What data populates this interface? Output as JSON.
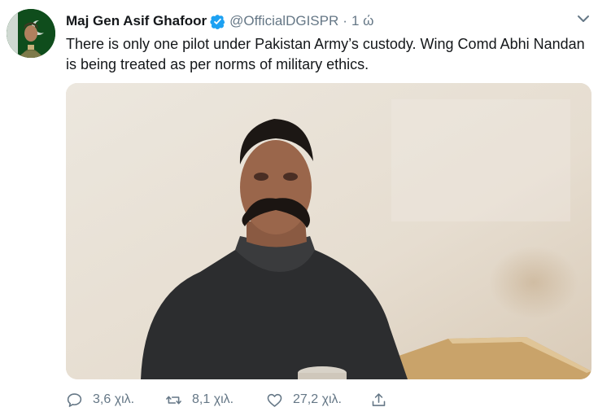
{
  "tweet": {
    "author_name": "Maj Gen Asif Ghafoor",
    "handle": "@OfficialDGISPR",
    "separator": "·",
    "time": "1 ώ",
    "text": "There is only one pilot under Pakistan Army’s custody. Wing Comd Abhi Nandan is being treated as per norms of military ethics."
  },
  "icons": {
    "verified": "verified-badge-icon",
    "caret": "chevron-down-icon",
    "reply": "reply-icon",
    "retweet": "retweet-icon",
    "like": "heart-icon",
    "share": "share-icon"
  },
  "stats": {
    "replies": "3,6 χιλ.",
    "retweets": "8,1 χιλ.",
    "likes": "27,2 χιλ."
  },
  "colors": {
    "verified_badge": "#1da1f2",
    "muted_text": "#657786",
    "primary_text": "#14171a"
  }
}
